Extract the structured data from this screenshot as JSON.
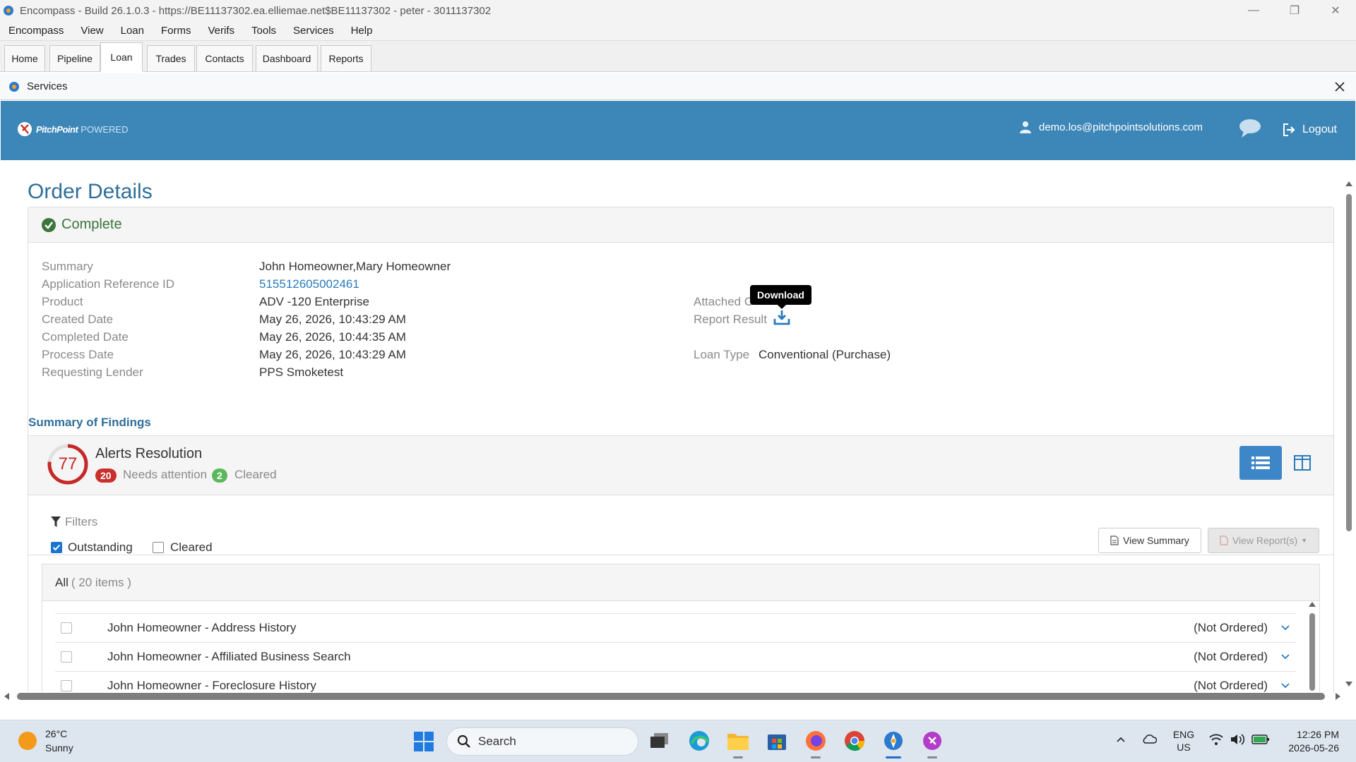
{
  "window": {
    "title": "Encompass - Build 26.1.0.3 - https://BE11137302.ea.elliemae.net$BE11137302 - peter - 3011137302",
    "minimize": "—",
    "maximize": "❐",
    "close": "✕"
  },
  "menu": [
    "Encompass",
    "View",
    "Loan",
    "Forms",
    "Verifs",
    "Tools",
    "Services",
    "Help"
  ],
  "tabs": [
    "Home",
    "Pipeline",
    "Loan",
    "Trades",
    "Contacts",
    "Dashboard",
    "Reports"
  ],
  "active_tab": "Loan",
  "services_bar": {
    "title": "Services"
  },
  "header": {
    "brand_name": "PitchPoint",
    "brand_suffix": "POWERED",
    "user_email": "demo.los@pitchpointsolutions.com",
    "logout_label": "Logout"
  },
  "order": {
    "page_title": "Order Details",
    "status": "Complete",
    "fields": [
      {
        "label": "Summary",
        "value": "John Homeowner,Mary Homeowner"
      },
      {
        "label": "Application Reference ID",
        "value": "515512605002461"
      },
      {
        "label": "Product",
        "value": "ADV -120 Enterprise"
      },
      {
        "label": "Created Date",
        "value": "May 26, 2026, 10:43:29 AM"
      },
      {
        "label": "Completed Date",
        "value": "May 26, 2026, 10:44:35 AM"
      },
      {
        "label": "Process Date",
        "value": "May 26, 2026, 10:43:29 AM"
      },
      {
        "label": "Requesting Lender",
        "value": "PPS Smoketest"
      }
    ],
    "attached_label": "Attached C",
    "report_result_label": "Report Result",
    "loan_type_label": "Loan Type",
    "loan_type_value": "Conventional (Purchase)",
    "tooltip": "Download"
  },
  "findings": {
    "section_title": "Summary of Findings",
    "score": "77",
    "score_fraction": 0.77,
    "alerts_title": "Alerts Resolution",
    "needs_attention_count": "20",
    "needs_attention_label": "Needs attention",
    "cleared_count": "2",
    "cleared_label": "Cleared",
    "filters_label": "Filters",
    "filter_outstanding": "Outstanding",
    "filter_cleared": "Cleared",
    "view_summary": "View Summary",
    "view_reports": "View Report(s)",
    "all_label": "All",
    "items_count": "( 20 items )",
    "items": [
      {
        "title": "John Homeowner - Address History",
        "status": "(Not Ordered)"
      },
      {
        "title": "John Homeowner - Affiliated Business Search",
        "status": "(Not Ordered)"
      },
      {
        "title": "John Homeowner - Foreclosure History",
        "status": "(Not Ordered)"
      }
    ]
  },
  "taskbar": {
    "weather_temp": "26°C",
    "weather_desc": "Sunny",
    "search_placeholder": "Search",
    "lang_top": "ENG",
    "lang_bottom": "US",
    "time": "12:26 PM",
    "date": "2026-05-26"
  },
  "colors": {
    "header_blue": "#3d87b8",
    "title_blue": "#2f6f9a",
    "complete_green": "#3c763d",
    "alert_red": "#c9302c",
    "cleared_green": "#5cb85c",
    "link_blue": "#2a7bbd"
  }
}
